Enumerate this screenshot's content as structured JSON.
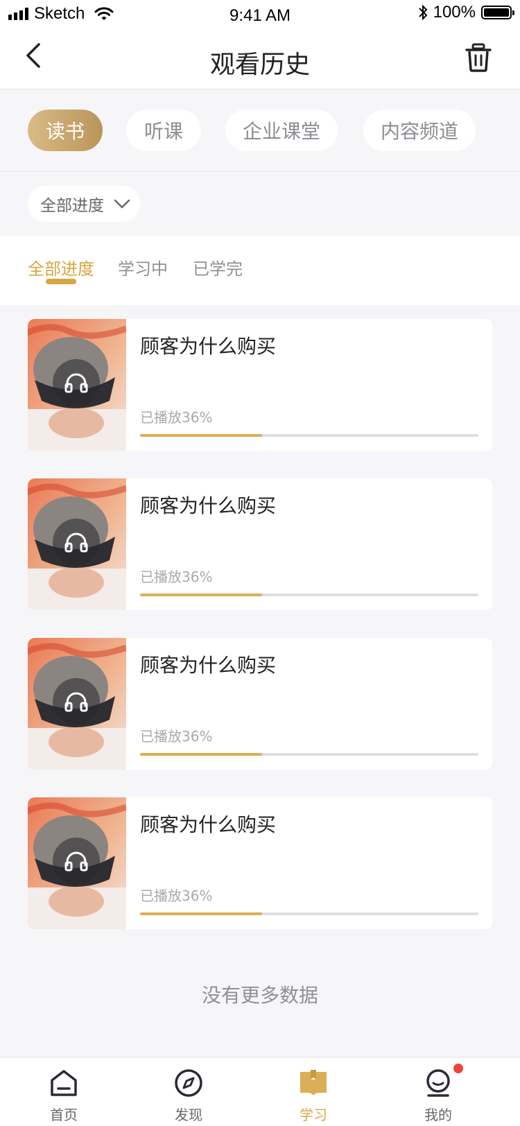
{
  "status_bar": {
    "carrier": "Sketch",
    "time": "9:41 AM",
    "battery": "100%"
  },
  "nav": {
    "title": "观看历史",
    "back_icon": "chevron-left-icon",
    "trash_icon": "trash-icon"
  },
  "category_tabs": [
    {
      "label": "读书",
      "active": true
    },
    {
      "label": "听课",
      "active": false
    },
    {
      "label": "企业课堂",
      "active": false
    },
    {
      "label": "内容频道",
      "active": false
    }
  ],
  "filter": {
    "selected": "全部进度"
  },
  "sub_tabs": [
    {
      "label": "全部进度",
      "active": true
    },
    {
      "label": "学习中",
      "active": false
    },
    {
      "label": "已学完",
      "active": false
    }
  ],
  "items": [
    {
      "title": "顾客为什么购买",
      "progress_label": "已播放36%",
      "progress": 0.36,
      "icon": "headphones-icon"
    },
    {
      "title": "顾客为什么购买",
      "progress_label": "已播放36%",
      "progress": 0.36,
      "icon": "headphones-icon"
    },
    {
      "title": "顾客为什么购买",
      "progress_label": "已播放36%",
      "progress": 0.36,
      "icon": "headphones-icon"
    },
    {
      "title": "顾客为什么购买",
      "progress_label": "已播放36%",
      "progress": 0.36,
      "icon": "headphones-icon"
    }
  ],
  "footer_text": "没有更多数据",
  "tab_bar": [
    {
      "label": "首页",
      "icon": "home-icon",
      "active": false
    },
    {
      "label": "发现",
      "icon": "compass-icon",
      "active": false
    },
    {
      "label": "学习",
      "icon": "book-icon",
      "active": true
    },
    {
      "label": "我的",
      "icon": "profile-icon",
      "active": false,
      "badge": true
    }
  ],
  "colors": {
    "accent": "#d9a640",
    "active_pill_start": "#d9bb86",
    "active_pill_end": "#b8955a",
    "progress_fill": "#dcae55",
    "badge": "#f0433a"
  }
}
